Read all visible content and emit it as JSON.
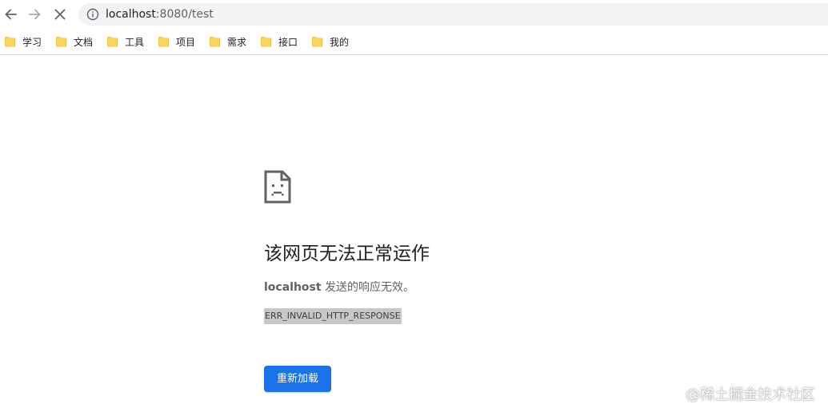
{
  "browser": {
    "address_bar": {
      "host": "localhost",
      "path": ":8080/test"
    },
    "bookmarks": [
      {
        "label": "学习"
      },
      {
        "label": "文档"
      },
      {
        "label": "工具"
      },
      {
        "label": "项目"
      },
      {
        "label": "需求"
      },
      {
        "label": "接口"
      },
      {
        "label": "我的"
      }
    ]
  },
  "error_page": {
    "title": "该网页无法正常运作",
    "description_host": "localhost",
    "description_text": " 发送的响应无效。",
    "error_code": "ERR_INVALID_HTTP_RESPONSE",
    "reload_button": "重新加载"
  },
  "watermark": "@稀土掘金技术社区",
  "colors": {
    "accent": "#1a73e8",
    "folder": "#fbd75b",
    "omnibox_bg": "#f1f3f4"
  },
  "icons": {
    "back": "back-arrow-icon",
    "forward": "forward-arrow-icon",
    "stop": "stop-loading-icon",
    "info": "info-icon",
    "folder": "folder-icon",
    "error": "sad-document-icon"
  }
}
